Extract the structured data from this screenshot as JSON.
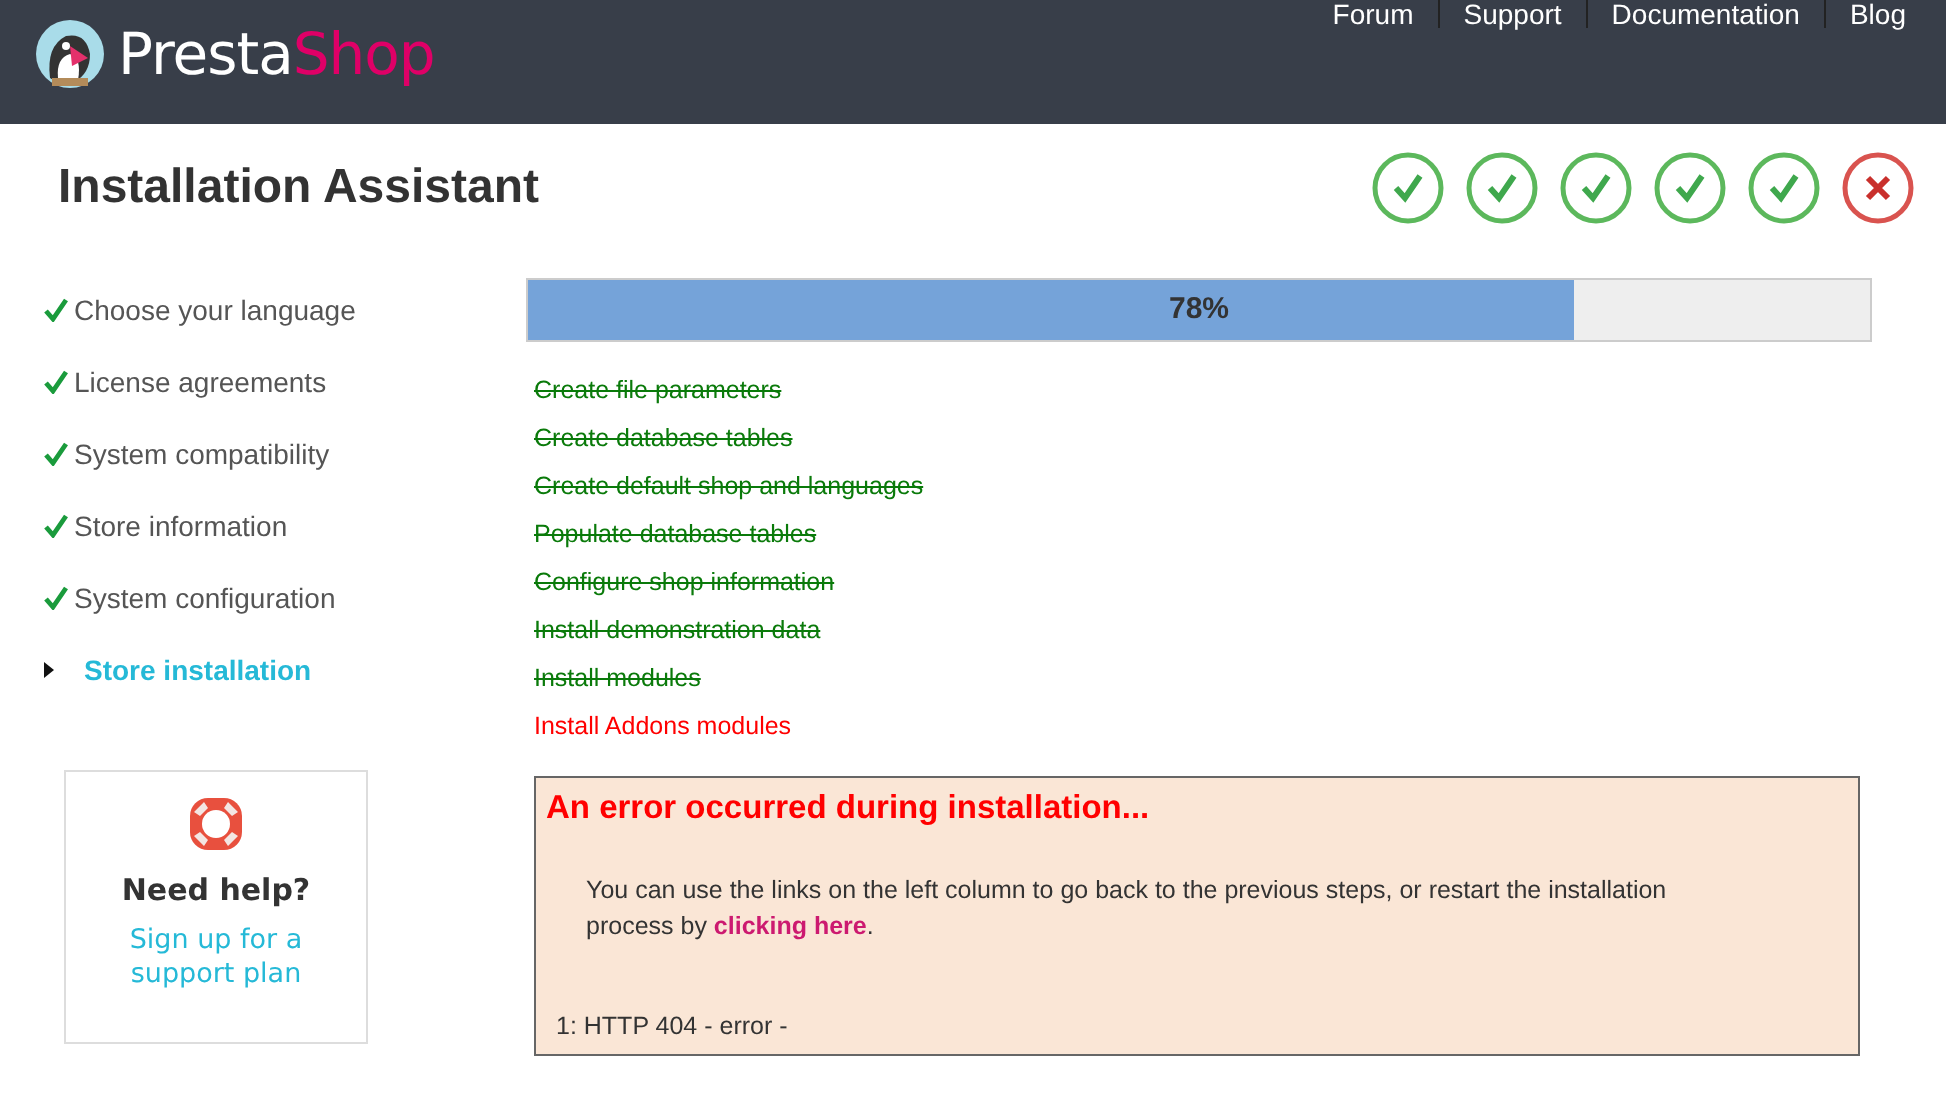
{
  "header": {
    "logo": {
      "part_1": "Presta",
      "part_2": "Shop"
    },
    "links": [
      "Forum",
      "Support",
      "Documentation",
      "Blog"
    ]
  },
  "title": "Installation Assistant",
  "step_marks": [
    {
      "done": true
    },
    {
      "done": true
    },
    {
      "done": true
    },
    {
      "done": true
    },
    {
      "done": true
    },
    {
      "done": false
    }
  ],
  "sidebar": {
    "steps": [
      {
        "label": "Choose your language",
        "done": true,
        "selected": false
      },
      {
        "label": "License agreements",
        "done": true,
        "selected": false
      },
      {
        "label": "System compatibility",
        "done": true,
        "selected": false
      },
      {
        "label": "Store information",
        "done": true,
        "selected": false
      },
      {
        "label": "System configuration",
        "done": true,
        "selected": false
      },
      {
        "label": "Store installation",
        "done": false,
        "selected": true
      }
    ],
    "help": {
      "title": "Need help?",
      "link": "Sign up for a support plan"
    }
  },
  "progress": {
    "level": 0.78,
    "reading": "78%"
  },
  "tasks": [
    {
      "label": "Create file parameters",
      "done": true
    },
    {
      "label": "Create database tables",
      "done": true
    },
    {
      "label": "Create default shop and languages",
      "done": true
    },
    {
      "label": "Populate database tables",
      "done": true
    },
    {
      "label": "Configure shop information",
      "done": true
    },
    {
      "label": "Install demonstration data",
      "done": true
    },
    {
      "label": "Install modules",
      "done": true
    },
    {
      "label": "Install Addons modules",
      "done": false
    }
  ],
  "error": {
    "title": "An error occurred during installation...",
    "message": "You can use the links on the left column to go back to the previous steps, or restart the installation process by ",
    "link": "clicking here",
    "message_end": ".",
    "detail": "1: HTTP 404 - error -"
  }
}
